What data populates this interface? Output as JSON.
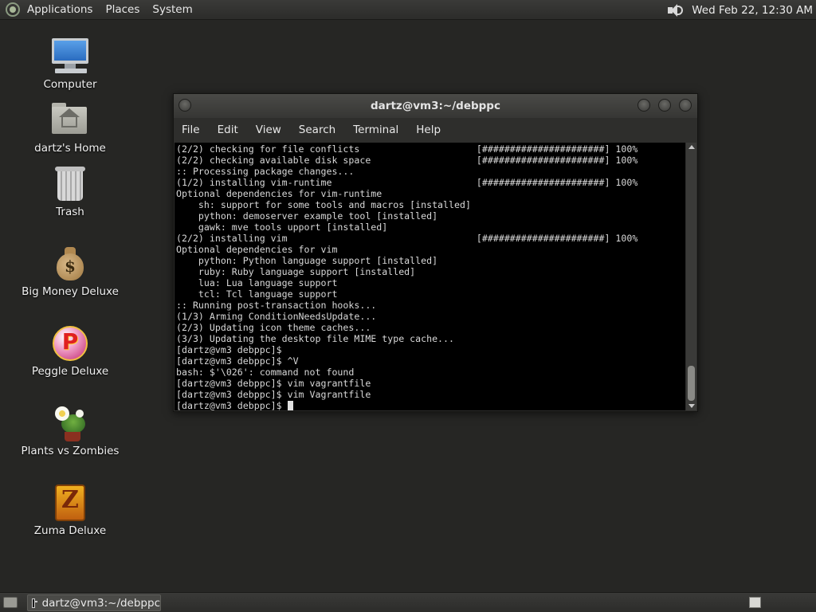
{
  "top_panel": {
    "menus": [
      "Applications",
      "Places",
      "System"
    ],
    "clock": "Wed Feb 22, 12:30 AM"
  },
  "desktop_icons": [
    {
      "label": "Computer",
      "icon": "computer-icon"
    },
    {
      "label": "dartz's Home",
      "icon": "home-folder-icon"
    },
    {
      "label": "Trash",
      "icon": "trash-icon"
    },
    {
      "label": "Big Money Deluxe",
      "icon": "money-bag-icon"
    },
    {
      "label": "Peggle Deluxe",
      "icon": "peggle-icon"
    },
    {
      "label": "Plants vs Zombies",
      "icon": "plants-vs-zombies-icon"
    },
    {
      "label": "Zuma Deluxe",
      "icon": "zuma-icon"
    }
  ],
  "terminal_window": {
    "title": "dartz@vm3:~/debppc",
    "menus": [
      "File",
      "Edit",
      "View",
      "Search",
      "Terminal",
      "Help"
    ],
    "lines": [
      "(2/2) checking for file conflicts                     [######################] 100%",
      "(2/2) checking available disk space                   [######################] 100%",
      ":: Processing package changes...",
      "(1/2) installing vim-runtime                          [######################] 100%",
      "Optional dependencies for vim-runtime",
      "    sh: support for some tools and macros [installed]",
      "    python: demoserver example tool [installed]",
      "    gawk: mve tools upport [installed]",
      "(2/2) installing vim                                  [######################] 100%",
      "Optional dependencies for vim",
      "    python: Python language support [installed]",
      "    ruby: Ruby language support [installed]",
      "    lua: Lua language support",
      "    tcl: Tcl language support",
      ":: Running post-transaction hooks...",
      "(1/3) Arming ConditionNeedsUpdate...",
      "(2/3) Updating icon theme caches...",
      "(3/3) Updating the desktop file MIME type cache...",
      "[dartz@vm3 debppc]$",
      "[dartz@vm3 debppc]$ ^V",
      "bash: $'\\026': command not found",
      "[dartz@vm3 debppc]$ vim vagrantfile",
      "[dartz@vm3 debppc]$ vim Vagrantfile"
    ],
    "prompt": "[dartz@vm3 debppc]$ "
  },
  "taskbar": {
    "task_label": "dartz@vm3:~/debppc"
  }
}
